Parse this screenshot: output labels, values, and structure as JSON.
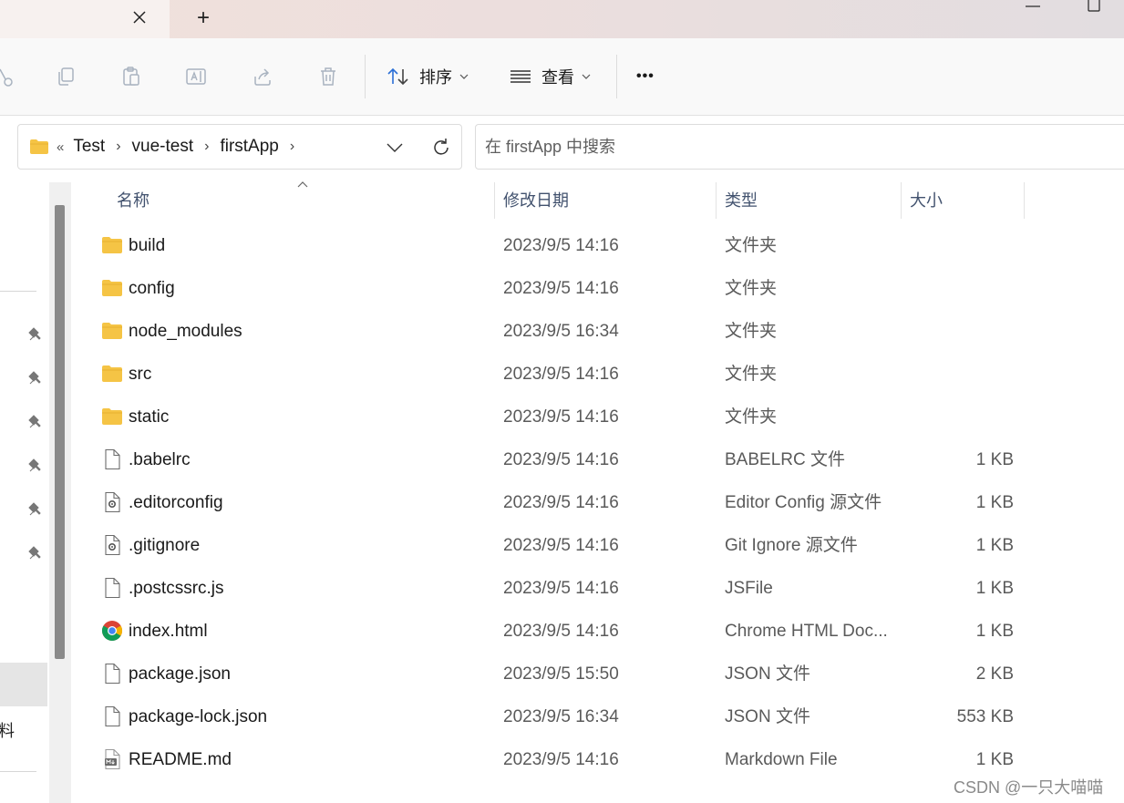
{
  "titlebar": {
    "new_tab_symbol": "+",
    "close_tab_icon": "close-icon"
  },
  "toolbar": {
    "sort_label": "排序",
    "view_label": "查看",
    "more_label": "•••"
  },
  "address": {
    "overflow_symbol": "«",
    "crumbs": [
      "Test",
      "vue-test",
      "firstApp"
    ],
    "separator": "›"
  },
  "search": {
    "placeholder": "在 firstApp 中搜索"
  },
  "columns": {
    "name": "名称",
    "date": "修改日期",
    "type": "类型",
    "size": "大小"
  },
  "nav": {
    "partial_char": "料"
  },
  "files": [
    {
      "name": "build",
      "date": "2023/9/5 14:16",
      "type": "文件夹",
      "size": "",
      "icon": "folder"
    },
    {
      "name": "config",
      "date": "2023/9/5 14:16",
      "type": "文件夹",
      "size": "",
      "icon": "folder"
    },
    {
      "name": "node_modules",
      "date": "2023/9/5 16:34",
      "type": "文件夹",
      "size": "",
      "icon": "folder"
    },
    {
      "name": "src",
      "date": "2023/9/5 14:16",
      "type": "文件夹",
      "size": "",
      "icon": "folder"
    },
    {
      "name": "static",
      "date": "2023/9/5 14:16",
      "type": "文件夹",
      "size": "",
      "icon": "folder"
    },
    {
      "name": ".babelrc",
      "date": "2023/9/5 14:16",
      "type": "BABELRC 文件",
      "size": "1 KB",
      "icon": "file"
    },
    {
      "name": ".editorconfig",
      "date": "2023/9/5 14:16",
      "type": "Editor Config 源文件",
      "size": "1 KB",
      "icon": "config-file"
    },
    {
      "name": ".gitignore",
      "date": "2023/9/5 14:16",
      "type": "Git Ignore 源文件",
      "size": "1 KB",
      "icon": "config-file"
    },
    {
      "name": ".postcssrc.js",
      "date": "2023/9/5 14:16",
      "type": "JSFile",
      "size": "1 KB",
      "icon": "file"
    },
    {
      "name": "index.html",
      "date": "2023/9/5 14:16",
      "type": "Chrome HTML Doc...",
      "size": "1 KB",
      "icon": "chrome"
    },
    {
      "name": "package.json",
      "date": "2023/9/5 15:50",
      "type": "JSON 文件",
      "size": "2 KB",
      "icon": "file"
    },
    {
      "name": "package-lock.json",
      "date": "2023/9/5 16:34",
      "type": "JSON 文件",
      "size": "553 KB",
      "icon": "file"
    },
    {
      "name": "README.md",
      "date": "2023/9/5 14:16",
      "type": "Markdown File",
      "size": "1 KB",
      "icon": "markdown"
    }
  ],
  "watermark": "CSDN @一只大喵喵",
  "colors": {
    "folder": "#f5c445",
    "header_text": "#42526e",
    "accent": "#2b6fd6"
  }
}
